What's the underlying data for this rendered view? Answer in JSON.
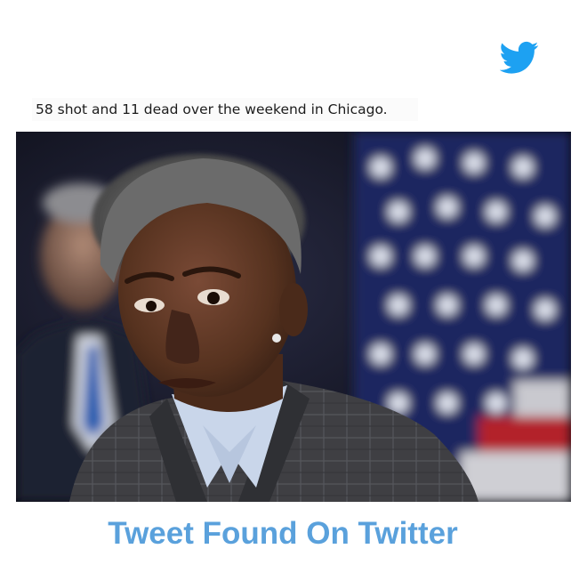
{
  "tweet": {
    "text": "58 shot and 11 dead over the weekend in Chicago.",
    "brand_icon": "twitter-bird-icon",
    "brand_color": "#1da1f2"
  },
  "photo": {
    "subject": "portrait-photo"
  },
  "caption": {
    "text": "Tweet Found On Twitter",
    "color": "#5aa1dc"
  }
}
